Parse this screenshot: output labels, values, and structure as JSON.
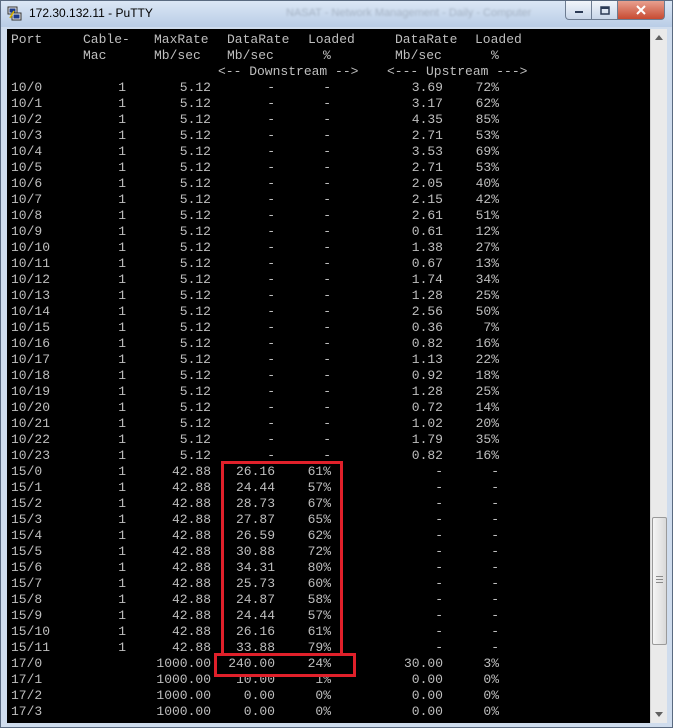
{
  "window": {
    "title": "172.30.132.11 - PuTTY",
    "background_title": "NASAT - Network Management - Daily - Computer"
  },
  "terminal": {
    "header_row1": [
      "Port",
      "Cable-",
      "MaxRate",
      "DataRate",
      "Loaded",
      "DataRate",
      "Loaded"
    ],
    "header_row2": [
      "",
      "Mac",
      "Mb/sec",
      "Mb/sec",
      "%",
      "Mb/sec",
      "%"
    ],
    "header_row3": [
      "<-- Downstream -->",
      "<--- Upstream --->"
    ],
    "rows": [
      [
        "10/0",
        "1",
        "5.12",
        "-",
        "-",
        "3.69",
        "72%"
      ],
      [
        "10/1",
        "1",
        "5.12",
        "-",
        "-",
        "3.17",
        "62%"
      ],
      [
        "10/2",
        "1",
        "5.12",
        "-",
        "-",
        "4.35",
        "85%"
      ],
      [
        "10/3",
        "1",
        "5.12",
        "-",
        "-",
        "2.71",
        "53%"
      ],
      [
        "10/4",
        "1",
        "5.12",
        "-",
        "-",
        "3.53",
        "69%"
      ],
      [
        "10/5",
        "1",
        "5.12",
        "-",
        "-",
        "2.71",
        "53%"
      ],
      [
        "10/6",
        "1",
        "5.12",
        "-",
        "-",
        "2.05",
        "40%"
      ],
      [
        "10/7",
        "1",
        "5.12",
        "-",
        "-",
        "2.15",
        "42%"
      ],
      [
        "10/8",
        "1",
        "5.12",
        "-",
        "-",
        "2.61",
        "51%"
      ],
      [
        "10/9",
        "1",
        "5.12",
        "-",
        "-",
        "0.61",
        "12%"
      ],
      [
        "10/10",
        "1",
        "5.12",
        "-",
        "-",
        "1.38",
        "27%"
      ],
      [
        "10/11",
        "1",
        "5.12",
        "-",
        "-",
        "0.67",
        "13%"
      ],
      [
        "10/12",
        "1",
        "5.12",
        "-",
        "-",
        "1.74",
        "34%"
      ],
      [
        "10/13",
        "1",
        "5.12",
        "-",
        "-",
        "1.28",
        "25%"
      ],
      [
        "10/14",
        "1",
        "5.12",
        "-",
        "-",
        "2.56",
        "50%"
      ],
      [
        "10/15",
        "1",
        "5.12",
        "-",
        "-",
        "0.36",
        "7%"
      ],
      [
        "10/16",
        "1",
        "5.12",
        "-",
        "-",
        "0.82",
        "16%"
      ],
      [
        "10/17",
        "1",
        "5.12",
        "-",
        "-",
        "1.13",
        "22%"
      ],
      [
        "10/18",
        "1",
        "5.12",
        "-",
        "-",
        "0.92",
        "18%"
      ],
      [
        "10/19",
        "1",
        "5.12",
        "-",
        "-",
        "1.28",
        "25%"
      ],
      [
        "10/20",
        "1",
        "5.12",
        "-",
        "-",
        "0.72",
        "14%"
      ],
      [
        "10/21",
        "1",
        "5.12",
        "-",
        "-",
        "1.02",
        "20%"
      ],
      [
        "10/22",
        "1",
        "5.12",
        "-",
        "-",
        "1.79",
        "35%"
      ],
      [
        "10/23",
        "1",
        "5.12",
        "-",
        "-",
        "0.82",
        "16%"
      ],
      [
        "15/0",
        "1",
        "42.88",
        "26.16",
        "61%",
        "-",
        "-"
      ],
      [
        "15/1",
        "1",
        "42.88",
        "24.44",
        "57%",
        "-",
        "-"
      ],
      [
        "15/2",
        "1",
        "42.88",
        "28.73",
        "67%",
        "-",
        "-"
      ],
      [
        "15/3",
        "1",
        "42.88",
        "27.87",
        "65%",
        "-",
        "-"
      ],
      [
        "15/4",
        "1",
        "42.88",
        "26.59",
        "62%",
        "-",
        "-"
      ],
      [
        "15/5",
        "1",
        "42.88",
        "30.88",
        "72%",
        "-",
        "-"
      ],
      [
        "15/6",
        "1",
        "42.88",
        "34.31",
        "80%",
        "-",
        "-"
      ],
      [
        "15/7",
        "1",
        "42.88",
        "25.73",
        "60%",
        "-",
        "-"
      ],
      [
        "15/8",
        "1",
        "42.88",
        "24.87",
        "58%",
        "-",
        "-"
      ],
      [
        "15/9",
        "1",
        "42.88",
        "24.44",
        "57%",
        "-",
        "-"
      ],
      [
        "15/10",
        "1",
        "42.88",
        "26.16",
        "61%",
        "-",
        "-"
      ],
      [
        "15/11",
        "1",
        "42.88",
        "33.88",
        "79%",
        "-",
        "-"
      ],
      [
        "17/0",
        "",
        "1000.00",
        "240.00",
        "24%",
        "30.00",
        "3%"
      ],
      [
        "17/1",
        "",
        "1000.00",
        "10.00",
        "1%",
        "0.00",
        "0%"
      ],
      [
        "17/2",
        "",
        "1000.00",
        "0.00",
        "0%",
        "0.00",
        "0%"
      ],
      [
        "17/3",
        "",
        "1000.00",
        "0.00",
        "0%",
        "0.00",
        "0%"
      ]
    ]
  },
  "colors": {
    "terminal_bg": "#000000",
    "terminal_text": "#bfbfbf",
    "highlight": "#e0202a"
  }
}
